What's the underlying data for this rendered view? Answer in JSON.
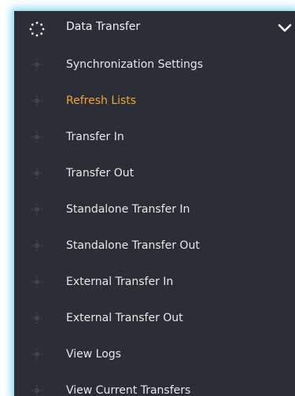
{
  "menu": {
    "header": {
      "label": "Data Transfer",
      "icon": "spinner-dots-icon",
      "expand_icon": "chevron-down-icon"
    },
    "items": [
      {
        "label": "Synchronization Settings",
        "active": false
      },
      {
        "label": "Refresh Lists",
        "active": true
      },
      {
        "label": "Transfer In",
        "active": false
      },
      {
        "label": "Transfer Out",
        "active": false
      },
      {
        "label": "Standalone Transfer In",
        "active": false
      },
      {
        "label": "Standalone Transfer Out",
        "active": false
      },
      {
        "label": "External Transfer In",
        "active": false
      },
      {
        "label": "External Transfer Out",
        "active": false
      },
      {
        "label": "View Logs",
        "active": false
      },
      {
        "label": "View Current Transfers",
        "active": false
      }
    ]
  },
  "colors": {
    "panel_background": "#2b2e37",
    "text": "#e8e8e8",
    "active_text": "#f2a531",
    "glow": "#8fd8f2"
  }
}
